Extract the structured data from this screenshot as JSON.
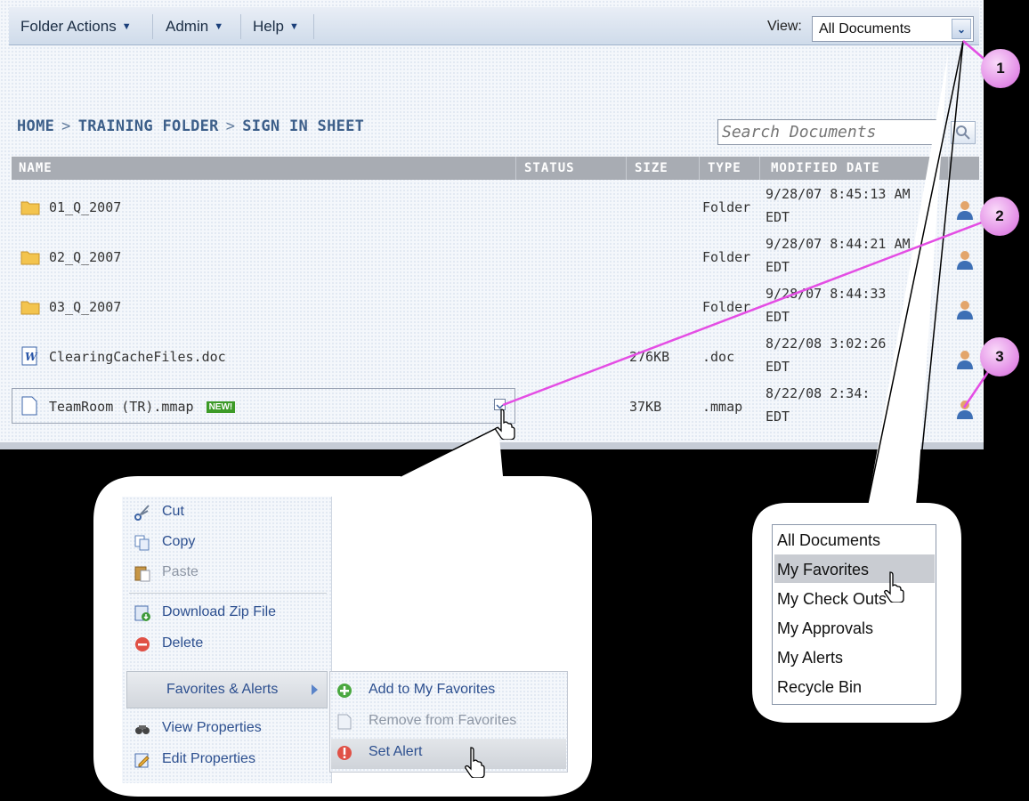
{
  "toolbar": {
    "menus": [
      "Folder Actions",
      "Admin",
      "Help"
    ],
    "view_label": "View:",
    "view_value": "All Documents"
  },
  "breadcrumb": [
    "HOME",
    "TRAINING FOLDER",
    "SIGN IN SHEET"
  ],
  "breadcrumb_separator": ">",
  "search": {
    "placeholder": "Search Documents"
  },
  "table": {
    "headers": [
      "NAME",
      "STATUS",
      "SIZE",
      "TYPE",
      "MODIFIED DATE"
    ],
    "rows": [
      {
        "icon": "folder-icon",
        "name": "01_Q_2007",
        "size": "",
        "type": "Folder",
        "date_line1": "9/28/07 8:45:13 AM",
        "date_line2": "EDT"
      },
      {
        "icon": "folder-icon",
        "name": "02_Q_2007",
        "size": "",
        "type": "Folder",
        "date_line1": "9/28/07 8:44:21 AM",
        "date_line2": "EDT"
      },
      {
        "icon": "folder-icon",
        "name": "03_Q_2007",
        "size": "",
        "type": "Folder",
        "date_line1": "9/28/07 8:44:33",
        "date_line2": "EDT"
      },
      {
        "icon": "word-doc-icon",
        "name": "ClearingCacheFiles.doc",
        "size": "276KB",
        "type": ".doc",
        "date_line1": "8/22/08 3:02:26",
        "date_line2": "EDT"
      },
      {
        "icon": "document-icon",
        "name": "TeamRoom (TR).mmap",
        "badge": "NEW!",
        "size": "37KB",
        "type": ".mmap",
        "date_line1": "8/22/08 2:34:",
        "date_line2": "EDT"
      }
    ]
  },
  "callouts": [
    "1",
    "2",
    "3"
  ],
  "context_menu": {
    "items": [
      {
        "label": "Cut",
        "icon": "scissors-icon",
        "disabled": false
      },
      {
        "label": "Copy",
        "icon": "copy-icon",
        "disabled": false
      },
      {
        "label": "Paste",
        "icon": "paste-icon",
        "disabled": true
      },
      {
        "label": "Download Zip File",
        "icon": "download-zip-icon",
        "disabled": false
      },
      {
        "label": "Delete",
        "icon": "delete-icon",
        "disabled": false
      },
      {
        "label": "Favorites & Alerts",
        "icon": "",
        "disabled": false
      },
      {
        "label": "View Properties",
        "icon": "view-properties-icon",
        "disabled": false
      },
      {
        "label": "Edit Properties",
        "icon": "edit-properties-icon",
        "disabled": false
      }
    ],
    "submenu": [
      {
        "label": "Add to My Favorites",
        "icon": "add-icon",
        "disabled": false
      },
      {
        "label": "Remove from Favorites",
        "icon": "page-icon",
        "disabled": true
      },
      {
        "label": "Set Alert",
        "icon": "alert-icon",
        "disabled": false
      }
    ]
  },
  "view_dropdown": [
    "All Documents",
    "My Favorites",
    "My Check Outs",
    "My Approvals",
    "My Alerts",
    "Recycle Bin"
  ],
  "colors": {
    "callout_line": "#e44de4",
    "badge_fill": "#e28ae6",
    "header_bg": "#a8acb3",
    "link_blue": "#2c4f8f"
  }
}
